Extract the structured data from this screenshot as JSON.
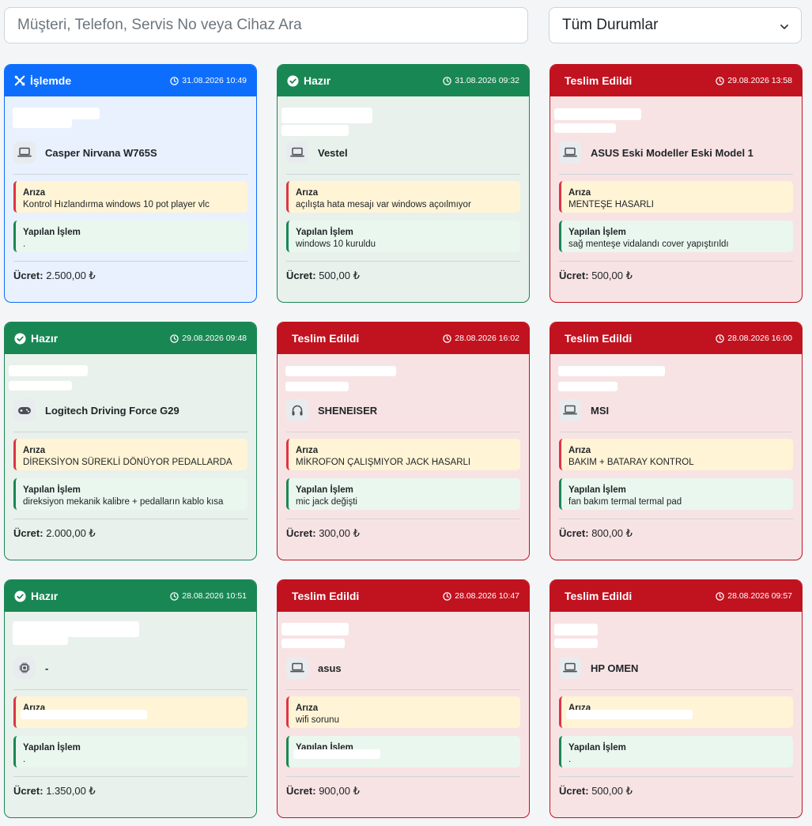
{
  "search": {
    "placeholder": "Müşteri, Telefon, Servis No veya Cihaz Ara",
    "value": ""
  },
  "filter": {
    "selected": "Tüm Durumlar",
    "icon": "chevron-down-icon"
  },
  "colors": {
    "islemde": "#0d6efd",
    "hazir": "#198754",
    "teslim": "#c1121f"
  },
  "labels": {
    "fault_title": "Arıza",
    "work_title": "Yapılan İşlem",
    "fee_label": "Ücret:"
  },
  "cards": [
    {
      "status": "İşlemde",
      "status_key": "islemde",
      "status_icon": "tools-icon",
      "date": "31.08.2026 10:49",
      "device_icon": "laptop-icon",
      "device": "Casper Nirvana W765S",
      "fault": "Kontrol Hızlandırma windows 10 pot player vlc",
      "work": ".",
      "fee": "2.500,00 ₺"
    },
    {
      "status": "Hazır",
      "status_key": "hazir",
      "status_icon": "check-circle-icon",
      "date": "31.08.2026 09:32",
      "device_icon": "laptop-icon",
      "device": "Vestel",
      "fault": "açılışta hata mesajı var windows açoılmıyor",
      "work": "windows 10 kuruldu",
      "fee": "500,00 ₺"
    },
    {
      "status": "Teslim Edildi",
      "status_key": "teslim",
      "status_icon": "",
      "date": "29.08.2026 13:58",
      "device_icon": "laptop-icon",
      "device": "ASUS Eski Modeller Eski Model 1",
      "fault": "MENTEŞE HASARLI",
      "work": "sağ menteşe vidalandı cover yapıştırıldı",
      "fee": "500,00 ₺"
    },
    {
      "status": "Hazır",
      "status_key": "hazir",
      "status_icon": "check-circle-icon",
      "date": "29.08.2026 09:48",
      "device_icon": "gamepad-icon",
      "device": "Logitech Driving Force G29",
      "fault": "DİREKSİYON SÜREKLİ DÖNÜYOR PEDALLARDA",
      "work": "direksiyon mekanik kalibre + pedalların kablo kısa",
      "fee": "2.000,00 ₺"
    },
    {
      "status": "Teslim Edildi",
      "status_key": "teslim",
      "status_icon": "",
      "date": "28.08.2026 16:02",
      "device_icon": "headphones-icon",
      "device": "SHENEISER",
      "fault": "MİKROFON ÇALIŞMIYOR JACK HASARLI",
      "work": "mic jack değişti",
      "fee": "300,00 ₺"
    },
    {
      "status": "Teslim Edildi",
      "status_key": "teslim",
      "status_icon": "",
      "date": "28.08.2026 16:00",
      "device_icon": "laptop-icon",
      "device": "MSI",
      "fault": "BAKIM + BATARAY KONTROL",
      "work": "fan bakım termal termal pad",
      "fee": "800,00 ₺"
    },
    {
      "status": "Hazır",
      "status_key": "hazir",
      "status_icon": "check-circle-icon",
      "date": "28.08.2026 10:51",
      "device_icon": "cpu-icon",
      "device": "-",
      "fault": "",
      "work": ".",
      "fee": "1.350,00 ₺"
    },
    {
      "status": "Teslim Edildi",
      "status_key": "teslim",
      "status_icon": "",
      "date": "28.08.2026 10:47",
      "device_icon": "laptop-icon",
      "device": "asus",
      "fault": "wifi sorunu",
      "work": "",
      "fee": "900,00 ₺"
    },
    {
      "status": "Teslim Edildi",
      "status_key": "teslim",
      "status_icon": "",
      "date": "28.08.2026 09:57",
      "device_icon": "laptop-icon",
      "device": "HP OMEN",
      "fault": "",
      "work": ".",
      "fee": "500,00 ₺"
    }
  ]
}
